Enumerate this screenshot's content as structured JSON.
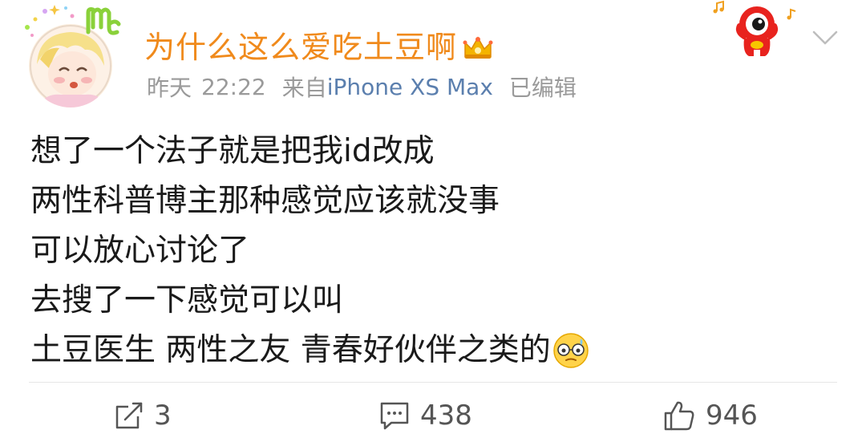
{
  "post": {
    "username": "为什么这么爱吃土豆啊",
    "date": "昨天",
    "time": "22:22",
    "source_prefix": "来自",
    "device": "iPhone XS Max",
    "edited": "已编辑",
    "content_lines": [
      "想了一个法子就是把我id改成",
      "两性科普博主那种感觉应该就没事",
      "可以放心讨论了",
      "去搜了一下感觉可以叫",
      "土豆医生 两性之友 青春好伙伴之类的"
    ],
    "trailing_emoji": "awkward-face-emoji"
  },
  "actions": {
    "repost_count": "3",
    "comment_count": "438",
    "like_count": "946"
  },
  "icons": {
    "crown": "crown-icon",
    "mascot": "weibo-mascot-icon",
    "chevron": "chevron-down-icon",
    "repost": "repost-icon",
    "comment": "comment-icon",
    "like": "thumbs-up-icon"
  },
  "colors": {
    "username": "#f08a1c",
    "device": "#5b7fae",
    "meta": "#9a9a9a",
    "text": "#1a1a1a"
  }
}
